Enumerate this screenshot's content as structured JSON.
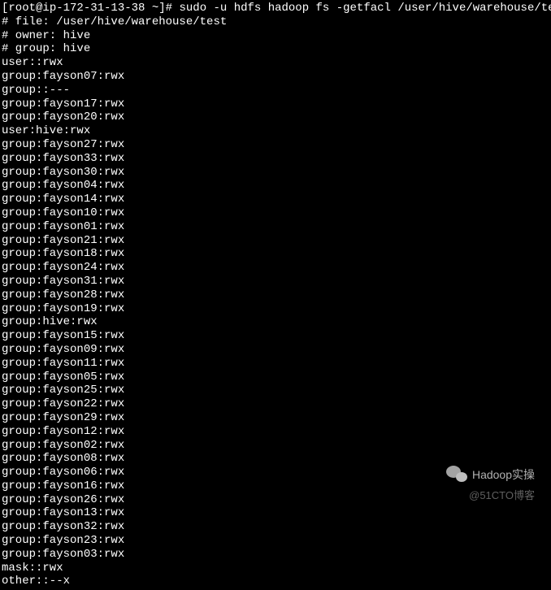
{
  "prompt": {
    "user": "root",
    "host": "ip-172-31-13-38",
    "path": "~",
    "symbol": "#",
    "command": "sudo -u hdfs hadoop fs -getfacl /user/hive/warehouse/test"
  },
  "output": [
    "# file: /user/hive/warehouse/test",
    "# owner: hive",
    "# group: hive",
    "user::rwx",
    "group:fayson07:rwx",
    "group::---",
    "group:fayson17:rwx",
    "group:fayson20:rwx",
    "user:hive:rwx",
    "group:fayson27:rwx",
    "group:fayson33:rwx",
    "group:fayson30:rwx",
    "group:fayson04:rwx",
    "group:fayson14:rwx",
    "group:fayson10:rwx",
    "group:fayson01:rwx",
    "group:fayson21:rwx",
    "group:fayson18:rwx",
    "group:fayson24:rwx",
    "group:fayson31:rwx",
    "group:fayson28:rwx",
    "group:fayson19:rwx",
    "group:hive:rwx",
    "group:fayson15:rwx",
    "group:fayson09:rwx",
    "group:fayson11:rwx",
    "group:fayson05:rwx",
    "group:fayson25:rwx",
    "group:fayson22:rwx",
    "group:fayson29:rwx",
    "group:fayson12:rwx",
    "group:fayson02:rwx",
    "group:fayson08:rwx",
    "group:fayson06:rwx",
    "group:fayson16:rwx",
    "group:fayson26:rwx",
    "group:fayson13:rwx",
    "group:fayson32:rwx",
    "group:fayson23:rwx",
    "group:fayson03:rwx",
    "mask::rwx",
    "other::--x"
  ],
  "watermark": {
    "wechat": "Hadoop实操",
    "cto": "@51CTO博客"
  }
}
